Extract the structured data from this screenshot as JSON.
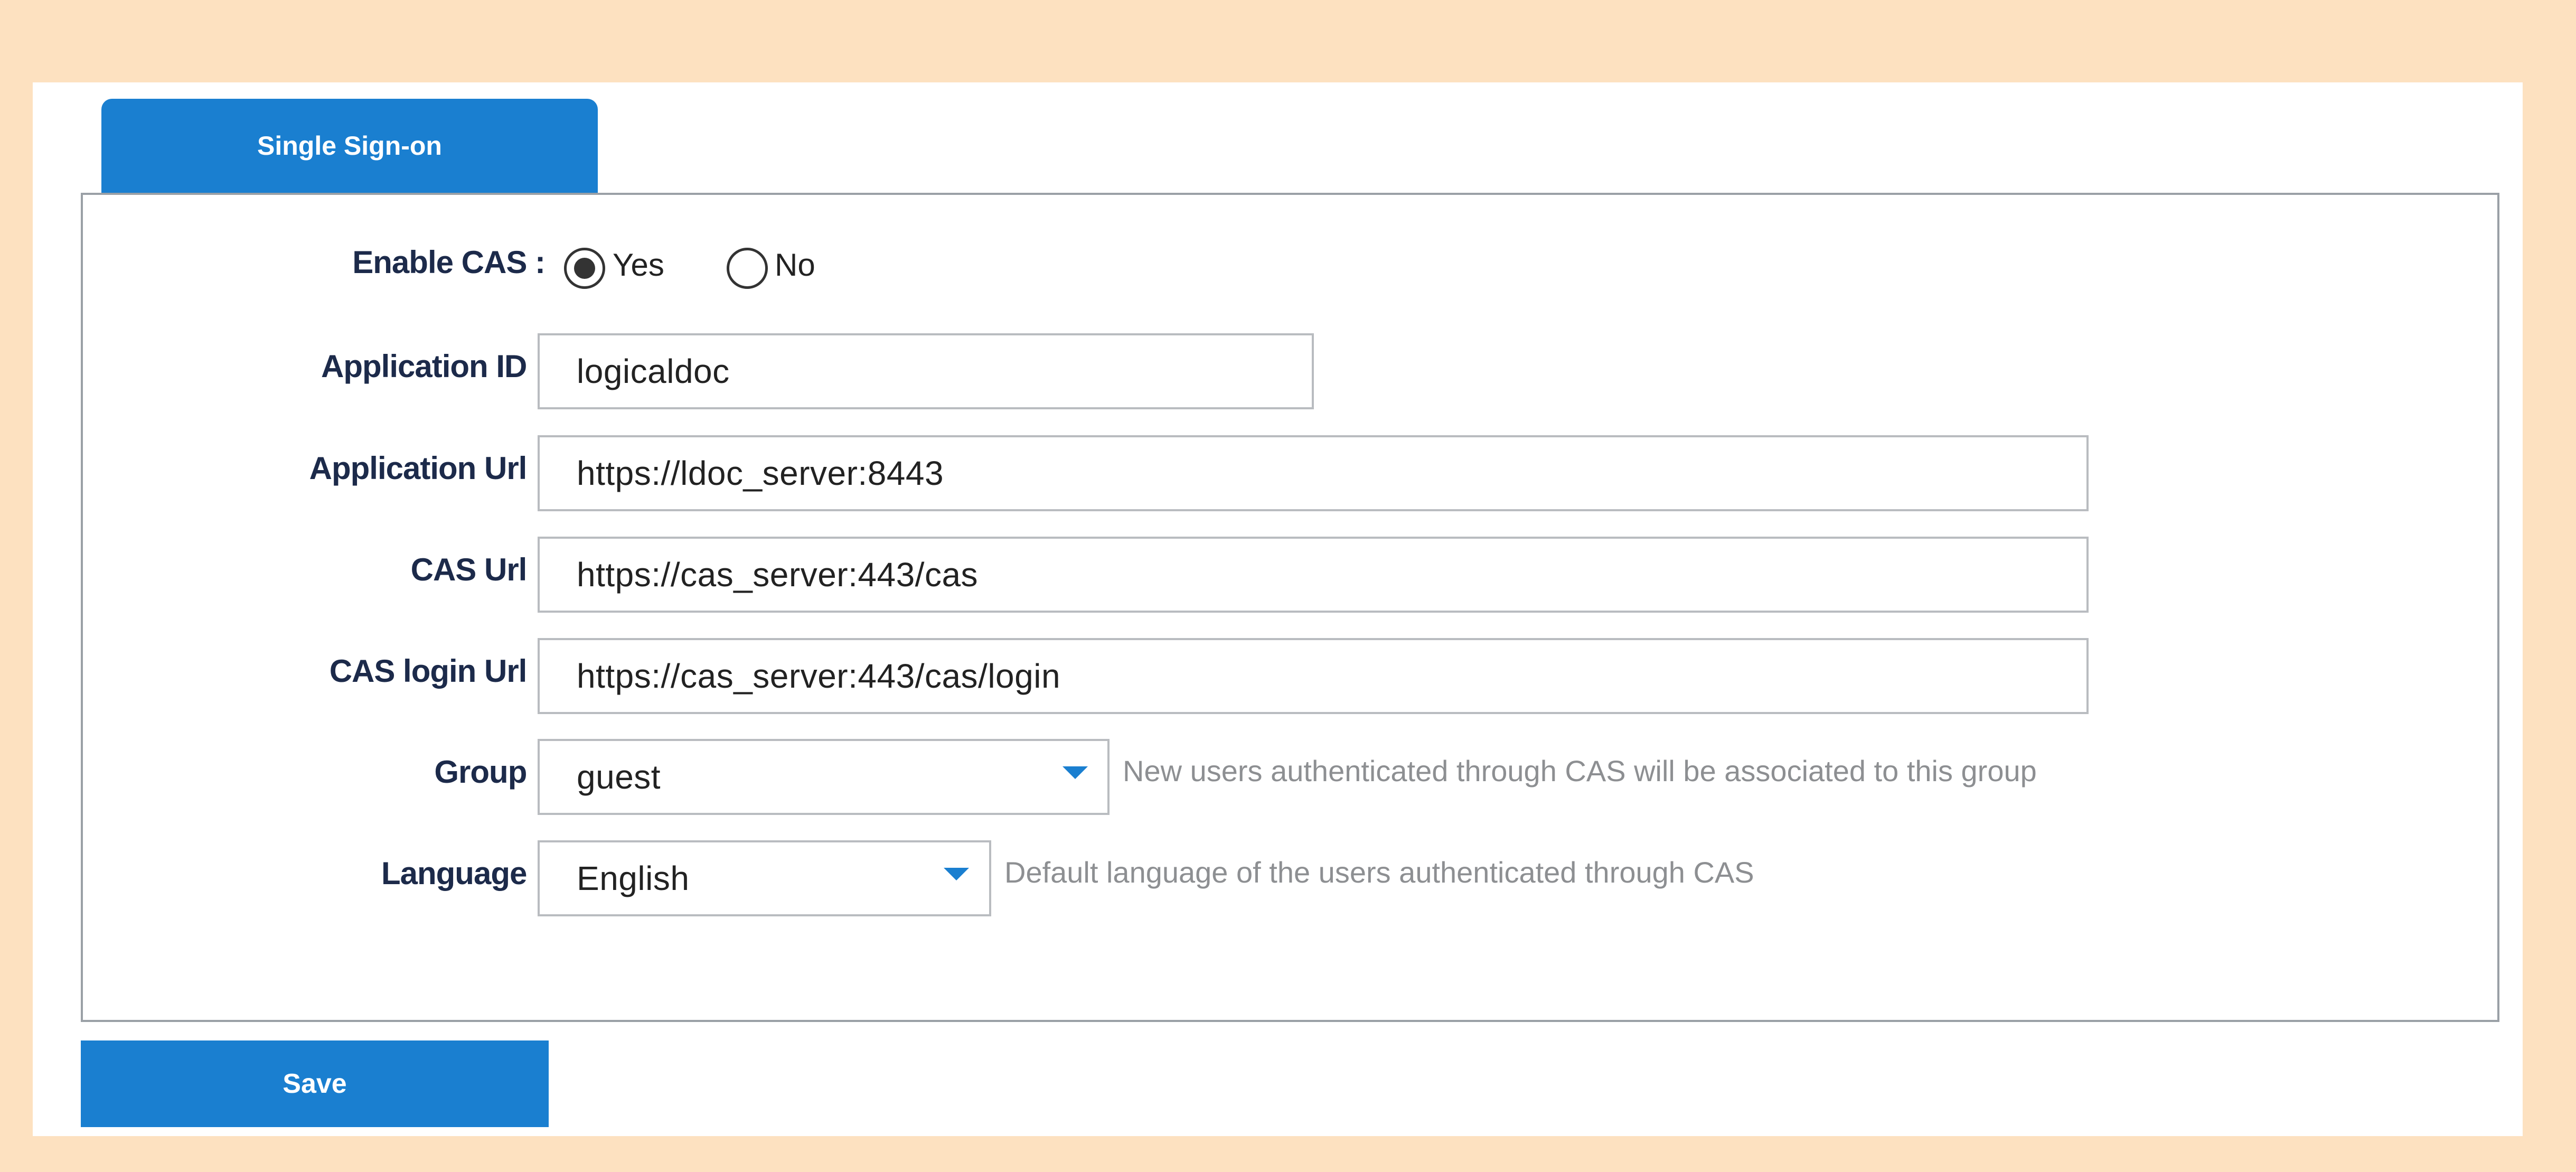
{
  "tab": {
    "label": "Single Sign-on"
  },
  "form": {
    "enable_cas": {
      "label": "Enable CAS :",
      "options": [
        {
          "label": "Yes",
          "selected": true
        },
        {
          "label": "No",
          "selected": false
        }
      ]
    },
    "application_id": {
      "label": "Application ID :",
      "value": "logicaldoc"
    },
    "application_url": {
      "label": "Application Url :",
      "value": "https://ldoc_server:8443"
    },
    "cas_url": {
      "label": "CAS Url :",
      "value": "https://cas_server:443/cas"
    },
    "cas_login_url": {
      "label": "CAS login Url :",
      "value": "https://cas_server:443/cas/login"
    },
    "group": {
      "label": "Group :",
      "value": "guest",
      "hint": "New users authenticated through CAS will be associated to this group"
    },
    "language": {
      "label": "Language :",
      "value": "English",
      "hint": "Default language of the users authenticated through CAS"
    }
  },
  "actions": {
    "save_label": "Save"
  },
  "colors": {
    "accent": "#1a7fd0",
    "frame": "#fde1c0",
    "border": "#9aa0a6",
    "hint_text": "#8d8f92"
  }
}
